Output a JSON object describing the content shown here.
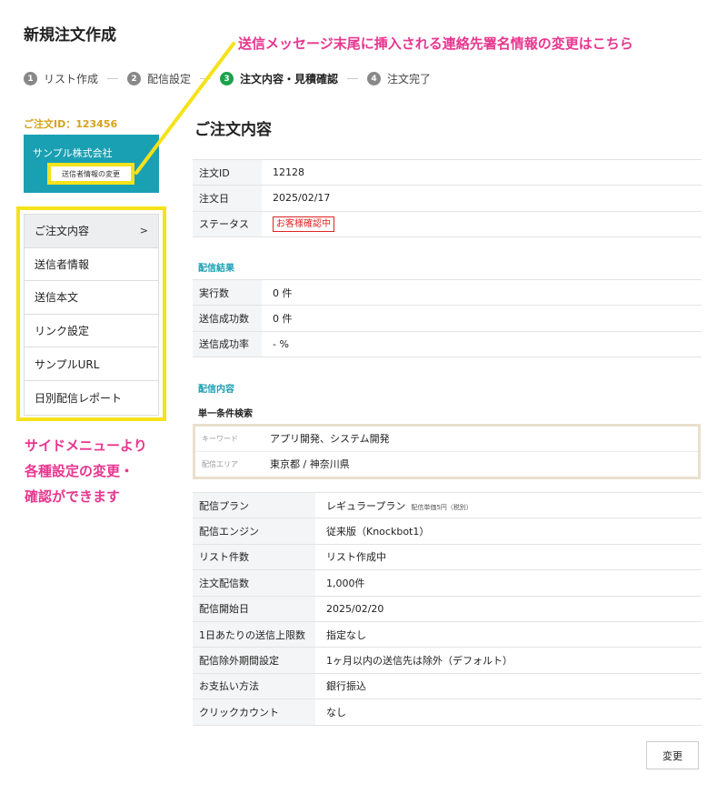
{
  "page": {
    "title": "新規注文作成"
  },
  "annotations": {
    "top": "送信メッセージ末尾に挿入される連絡先署名情報の変更はこちら",
    "side_lines": [
      "サイドメニューより",
      "各種設定の変更・",
      "確認ができます"
    ]
  },
  "steps": [
    {
      "num": "1",
      "label": "リスト作成"
    },
    {
      "num": "2",
      "label": "配信設定"
    },
    {
      "num": "3",
      "label": "注文内容・見積確認"
    },
    {
      "num": "4",
      "label": "注文完了"
    }
  ],
  "sidebar": {
    "order_id": "ご注文ID：123456",
    "company_name": "サンプル株式会社",
    "sender_change_label": "送信者情報の変更",
    "items": [
      {
        "label": "ご注文内容",
        "arrow": ">"
      },
      {
        "label": "送信者情報"
      },
      {
        "label": "送信本文"
      },
      {
        "label": "リンク設定"
      },
      {
        "label": "サンプルURL"
      },
      {
        "label": "日別配信レポート"
      }
    ]
  },
  "main": {
    "title": "ご注文内容",
    "order": {
      "rows": [
        {
          "label": "注文ID",
          "value": "12128"
        },
        {
          "label": "注文日",
          "value": "2025/02/17"
        },
        {
          "label": "ステータス",
          "value": "お客様確認中"
        }
      ]
    },
    "result": {
      "heading": "配信結果",
      "rows": [
        {
          "label": "実行数",
          "value": "0 件"
        },
        {
          "label": "送信成功数",
          "value": "0 件"
        },
        {
          "label": "送信成功率",
          "value": "- %"
        }
      ]
    },
    "content": {
      "heading": "配信内容",
      "search_heading": "単一条件検索",
      "conditions": [
        {
          "label": "キーワード",
          "value": "アプリ開発、システム開発"
        },
        {
          "label": "配信エリア",
          "value": "東京都 / 神奈川県"
        }
      ]
    },
    "plan": {
      "rows": [
        {
          "label": "配信プラン",
          "value": "レギュラープラン",
          "note": "配信単価5円（税別）"
        },
        {
          "label": "配信エンジン",
          "value": "従来版（Knockbot1）"
        },
        {
          "label": "リスト件数",
          "value": "リスト作成中"
        },
        {
          "label": "注文配信数",
          "value": "1,000件"
        },
        {
          "label": "配信開始日",
          "value": "2025/02/20"
        },
        {
          "label": "1日あたりの送信上限数",
          "value": "指定なし"
        },
        {
          "label": "配信除外期間設定",
          "value": "1ヶ月以内の送信先は除外（デフォルト）"
        },
        {
          "label": "お支払い方法",
          "value": "銀行振込"
        },
        {
          "label": "クリックカウント",
          "value": "なし"
        }
      ]
    },
    "change_label": "変更"
  },
  "colors": {
    "accent_teal": "#1aa0b3",
    "highlight_yellow": "#f5e21a",
    "annotation_pink": "#e8368f",
    "step_active_green": "#1aa34a",
    "order_id_gold": "#d4a21b",
    "status_red": "#e02424"
  }
}
